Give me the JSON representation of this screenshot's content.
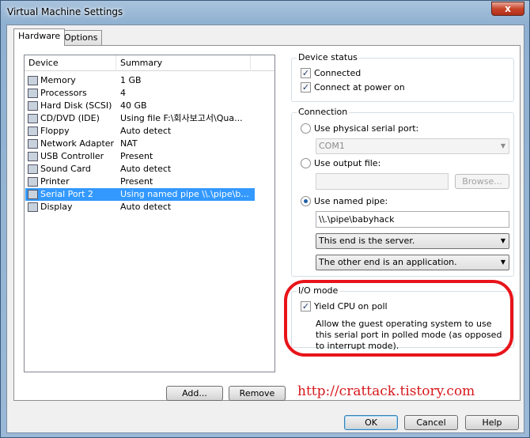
{
  "window": {
    "title": "Virtual Machine Settings",
    "close_label": "x"
  },
  "tabs": [
    {
      "label": "Hardware"
    },
    {
      "label": "Options"
    }
  ],
  "device_list": {
    "columns": {
      "device": "Device",
      "summary": "Summary"
    },
    "rows": [
      {
        "device": "Memory",
        "summary": "1 GB",
        "icon": "memory-icon"
      },
      {
        "device": "Processors",
        "summary": "4",
        "icon": "processor-icon"
      },
      {
        "device": "Hard Disk (SCSI)",
        "summary": "40 GB",
        "icon": "hard-disk-icon"
      },
      {
        "device": "CD/DVD (IDE)",
        "summary": "Using file F:\\회사보고서\\Qua...",
        "icon": "cd-dvd-icon"
      },
      {
        "device": "Floppy",
        "summary": "Auto detect",
        "icon": "floppy-icon"
      },
      {
        "device": "Network Adapter",
        "summary": "NAT",
        "icon": "network-adapter-icon"
      },
      {
        "device": "USB Controller",
        "summary": "Present",
        "icon": "usb-icon"
      },
      {
        "device": "Sound Card",
        "summary": "Auto detect",
        "icon": "sound-card-icon"
      },
      {
        "device": "Printer",
        "summary": "Present",
        "icon": "printer-icon"
      },
      {
        "device": "Serial Port 2",
        "summary": "Using named pipe \\\\.\\pipe\\b...",
        "icon": "serial-port-icon"
      },
      {
        "device": "Display",
        "summary": "Auto detect",
        "icon": "display-icon"
      }
    ],
    "selected_index": 9
  },
  "list_buttons": {
    "add": "Add...",
    "remove": "Remove"
  },
  "device_status": {
    "title": "Device status",
    "connected": {
      "label": "Connected",
      "checked": true
    },
    "connect_at_power_on": {
      "label": "Connect at power on",
      "checked": true
    }
  },
  "connection": {
    "title": "Connection",
    "physical_serial_port": {
      "label": "Use physical serial port:",
      "value": "COM1",
      "selected": false
    },
    "output_file": {
      "label": "Use output file:",
      "value": "",
      "browse": "Browse...",
      "selected": false
    },
    "named_pipe": {
      "label": "Use named pipe:",
      "value": "\\\\.\\pipe\\babyhack",
      "selected": true,
      "end_select": "This end is the server.",
      "other_select": "The other end is an application."
    }
  },
  "io_mode": {
    "title": "I/O mode",
    "yield_cpu": {
      "label": "Yield CPU on poll",
      "checked": true
    },
    "description": "Allow the guest operating system to use this serial port in polled mode (as opposed to interrupt mode)."
  },
  "watermark": "http://crattack.tistory.com",
  "dialog_buttons": {
    "ok": "OK",
    "cancel": "Cancel",
    "help": "Help"
  },
  "colors": {
    "selection": "#3399ff",
    "highlight_ring": "#e8141a",
    "watermark": "#d7181c"
  }
}
